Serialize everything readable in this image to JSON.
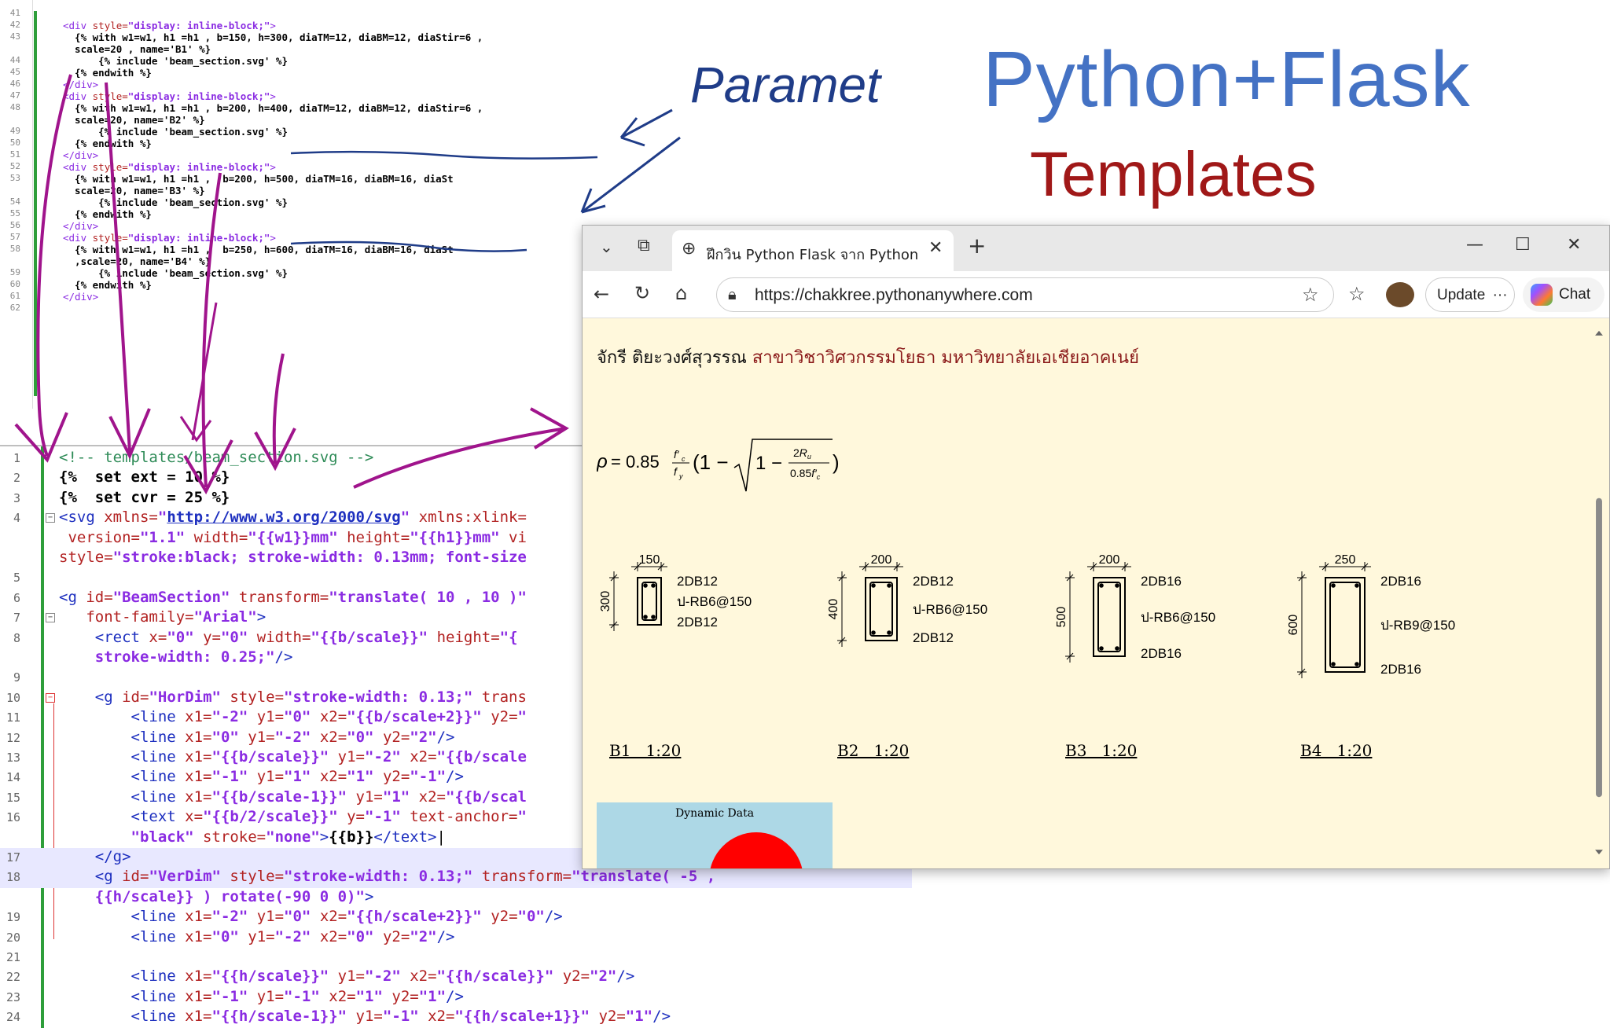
{
  "slide": {
    "title_main": "Python+Flask",
    "title_sub": "Templates",
    "handwritten_note": "Paramet"
  },
  "top_editor": {
    "lines": [
      {
        "num": "41",
        "html": ""
      },
      {
        "num": "42",
        "html": "<span class='tag'>&lt;div</span> <span class='attr'>style=</span><span class='str'>\"display: inline-block;\"</span><span class='tag'>&gt;</span>"
      },
      {
        "num": "43",
        "html": "  {% with w1=w1, h1 =h1 , b=150, h=300, diaTM=12, diaBM=12, diaStir=6 ,"
      },
      {
        "num": "",
        "html": "  scale=20 , name='B1' %}"
      },
      {
        "num": "44",
        "html": "      {% include 'beam_section.svg' %}"
      },
      {
        "num": "45",
        "html": "  {% endwith %}"
      },
      {
        "num": "46",
        "html": "<span class='tag'>&lt;/div&gt;</span>"
      },
      {
        "num": "47",
        "html": "<span class='tag'>&lt;div</span> <span class='attr'>style=</span><span class='str'>\"display: inline-block;\"</span><span class='tag'>&gt;</span>"
      },
      {
        "num": "48",
        "html": "  {% with w1=w1, h1 =h1 , b=200, h=400, diaTM=12, diaBM=12, diaStir=6 ,"
      },
      {
        "num": "",
        "html": "  scale=20, name='B2' %}"
      },
      {
        "num": "49",
        "html": "      {% include 'beam_section.svg' %}"
      },
      {
        "num": "50",
        "html": "  {% endwith %}"
      },
      {
        "num": "51",
        "html": "<span class='tag'>&lt;/div&gt;</span>"
      },
      {
        "num": "52",
        "html": "<span class='tag'>&lt;div</span> <span class='attr'>style=</span><span class='str'>\"display: inline-block;\"</span><span class='tag'>&gt;</span>"
      },
      {
        "num": "53",
        "html": "  {% with w1=w1, h1 =h1 ,  b=200, h=500, diaTM=16, diaBM=16, diaSt"
      },
      {
        "num": "",
        "html": "  scale=20, name='B3' %}"
      },
      {
        "num": "54",
        "html": "      {% include 'beam_section.svg' %}"
      },
      {
        "num": "55",
        "html": "  {% endwith %}"
      },
      {
        "num": "56",
        "html": "<span class='tag'>&lt;/div&gt;</span>"
      },
      {
        "num": "57",
        "html": "<span class='tag'>&lt;div</span> <span class='attr'>style=</span><span class='str'>\"display: inline-block;\"</span><span class='tag'>&gt;</span>"
      },
      {
        "num": "58",
        "html": "  {% with w1=w1, h1 =h1 ,  b=250, h=600, diaTM=16, diaBM=16, diaSt"
      },
      {
        "num": "",
        "html": "  ,scale=20, name='B4' %}"
      },
      {
        "num": "59",
        "html": "      {% include 'beam_section.svg' %}"
      },
      {
        "num": "60",
        "html": "  {% endwith %}"
      },
      {
        "num": "61",
        "html": "<span class='tag'>&lt;/div&gt;</span>"
      },
      {
        "num": "62",
        "html": ""
      }
    ]
  },
  "bottom_editor": {
    "lines": [
      {
        "num": "1",
        "html": "<span class='c-com'>&lt;!-- templates/beam_section.svg --&gt;</span>"
      },
      {
        "num": "2",
        "html": "<span class='c-jinja'>{%  set ext = 10 %}</span>"
      },
      {
        "num": "3",
        "html": "<span class='c-jinja'>{%  set cvr = 25 %}</span>"
      },
      {
        "num": "4",
        "html": "<span class='c-tag'>&lt;svg</span> <span class='c-attr'>xmlns=</span><span class='c-str'>\"</span><span class='c-link'>http://www.w3.org/2000/svg</span><span class='c-str'>\"</span> <span class='c-attr'>xmlns:xlink=</span>"
      },
      {
        "num": "",
        "html": " <span class='c-attr'>version=</span><span class='c-str'>\"1.1\"</span> <span class='c-attr'>width=</span><span class='c-str'>\"{{w1}}mm\"</span> <span class='c-attr'>height=</span><span class='c-str'>\"{{h1}}mm\"</span> <span class='c-attr'>vi</span>"
      },
      {
        "num": "",
        "html": "<span class='c-attr'>style=</span><span class='c-str'>\"stroke:black; stroke-width: 0.13mm; font-size</span>"
      },
      {
        "num": "5",
        "html": ""
      },
      {
        "num": "6",
        "html": "<span class='c-tag'>&lt;g</span> <span class='c-attr'>id=</span><span class='c-str'>\"BeamSection\"</span> <span class='c-attr'>transform=</span><span class='c-str'>\"translate( 10 , 10 )\"</span>"
      },
      {
        "num": "7",
        "html": "   <span class='c-attr'>font-family=</span><span class='c-str'>\"Arial\"</span><span class='c-tag'>&gt;</span>"
      },
      {
        "num": "8",
        "html": "    <span class='c-tag'>&lt;rect</span> <span class='c-attr'>x=</span><span class='c-str'>\"0\"</span> <span class='c-attr'>y=</span><span class='c-str'>\"0\"</span> <span class='c-attr'>width=</span><span class='c-str'>\"{{b/scale}}\"</span> <span class='c-attr'>height=</span><span class='c-str'>\"{</span>"
      },
      {
        "num": "",
        "html": "    <span class='c-str'>stroke-width: 0.25;\"</span><span class='c-tag'>/&gt;</span>"
      },
      {
        "num": "9",
        "html": ""
      },
      {
        "num": "10",
        "html": "    <span class='c-tag'>&lt;g</span> <span class='c-attr'>id=</span><span class='c-str'>\"HorDim\"</span> <span class='c-attr'>style=</span><span class='c-str'>\"stroke-width: 0.13;\"</span> <span class='c-attr'>trans</span>"
      },
      {
        "num": "11",
        "html": "        <span class='c-tag'>&lt;line</span> <span class='c-attr'>x1=</span><span class='c-str'>\"-2\"</span> <span class='c-attr'>y1=</span><span class='c-str'>\"0\"</span> <span class='c-attr'>x2=</span><span class='c-str'>\"{{b/scale+2}}\"</span> <span class='c-attr'>y2=</span><span class='c-str'>\"</span>"
      },
      {
        "num": "12",
        "html": "        <span class='c-tag'>&lt;line</span> <span class='c-attr'>x1=</span><span class='c-str'>\"0\"</span> <span class='c-attr'>y1=</span><span class='c-str'>\"-2\"</span> <span class='c-attr'>x2=</span><span class='c-str'>\"0\"</span> <span class='c-attr'>y2=</span><span class='c-str'>\"2\"</span><span class='c-tag'>/&gt;</span>"
      },
      {
        "num": "13",
        "html": "        <span class='c-tag'>&lt;line</span> <span class='c-attr'>x1=</span><span class='c-str'>\"{{b/scale}}\"</span> <span class='c-attr'>y1=</span><span class='c-str'>\"-2\"</span> <span class='c-attr'>x2=</span><span class='c-str'>\"{{b/scale</span>"
      },
      {
        "num": "14",
        "html": "        <span class='c-tag'>&lt;line</span> <span class='c-attr'>x1=</span><span class='c-str'>\"-1\"</span> <span class='c-attr'>y1=</span><span class='c-str'>\"1\"</span> <span class='c-attr'>x2=</span><span class='c-str'>\"1\"</span> <span class='c-attr'>y2=</span><span class='c-str'>\"-1\"</span><span class='c-tag'>/&gt;</span>"
      },
      {
        "num": "15",
        "html": "        <span class='c-tag'>&lt;line</span> <span class='c-attr'>x1=</span><span class='c-str'>\"{{b/scale-1}}\"</span> <span class='c-attr'>y1=</span><span class='c-str'>\"1\"</span> <span class='c-attr'>x2=</span><span class='c-str'>\"{{b/scal</span>"
      },
      {
        "num": "16",
        "html": "        <span class='c-tag'>&lt;text</span> <span class='c-attr'>x=</span><span class='c-str'>\"{{b/2/scale}}\"</span> <span class='c-attr'>y=</span><span class='c-str'>\"-1\"</span> <span class='c-attr'>text-anchor=</span><span class='c-str'>\"</span>"
      },
      {
        "num": "",
        "html": "        <span class='c-str'>\"black\"</span> <span class='c-attr'>stroke=</span><span class='c-str'>\"none\"</span><span class='c-tag'>&gt;</span><span class='c-jinja'>{{b}}</span><span class='c-tag'>&lt;/text&gt;</span>|"
      },
      {
        "num": "17",
        "html": "    <span class='c-tag'>&lt;/g&gt;</span>"
      },
      {
        "num": "18",
        "html": "    <span class='c-tag'>&lt;g</span> <span class='c-attr'>id=</span><span class='c-str'>\"VerDim\"</span> <span class='c-attr'>style=</span><span class='c-str'>\"stroke-width: 0.13;\"</span> <span class='c-attr'>transform=</span><span class='c-str'>\"translate( -5 ,</span>"
      },
      {
        "num": "",
        "html": "    <span class='c-str'>{{h/scale}} ) rotate(-90 0 0)\"</span><span class='c-tag'>&gt;</span>"
      },
      {
        "num": "19",
        "html": "        <span class='c-tag'>&lt;line</span> <span class='c-attr'>x1=</span><span class='c-str'>\"-2\"</span> <span class='c-attr'>y1=</span><span class='c-str'>\"0\"</span> <span class='c-attr'>x2=</span><span class='c-str'>\"{{h/scale+2}}\"</span> <span class='c-attr'>y2=</span><span class='c-str'>\"0\"</span><span class='c-tag'>/&gt;</span>"
      },
      {
        "num": "20",
        "html": "        <span class='c-tag'>&lt;line</span> <span class='c-attr'>x1=</span><span class='c-str'>\"0\"</span> <span class='c-attr'>y1=</span><span class='c-str'>\"-2\"</span> <span class='c-attr'>x2=</span><span class='c-str'>\"0\"</span> <span class='c-attr'>y2=</span><span class='c-str'>\"2\"</span><span class='c-tag'>/&gt;</span>"
      },
      {
        "num": "21",
        "html": ""
      },
      {
        "num": "22",
        "html": "        <span class='c-tag'>&lt;line</span> <span class='c-attr'>x1=</span><span class='c-str'>\"{{h/scale}}\"</span> <span class='c-attr'>y1=</span><span class='c-str'>\"-2\"</span> <span class='c-attr'>x2=</span><span class='c-str'>\"{{h/scale}}\"</span> <span class='c-attr'>y2=</span><span class='c-str'>\"2\"</span><span class='c-tag'>/&gt;</span>"
      },
      {
        "num": "23",
        "html": "        <span class='c-tag'>&lt;line</span> <span class='c-attr'>x1=</span><span class='c-str'>\"-1\"</span> <span class='c-attr'>y1=</span><span class='c-str'>\"-1\"</span> <span class='c-attr'>x2=</span><span class='c-str'>\"1\"</span> <span class='c-attr'>y2=</span><span class='c-str'>\"1\"</span><span class='c-tag'>/&gt;</span>"
      },
      {
        "num": "24",
        "html": "        <span class='c-tag'>&lt;line</span> <span class='c-attr'>x1=</span><span class='c-str'>\"{{h/scale-1}}\"</span> <span class='c-attr'>y1=</span><span class='c-str'>\"-1\"</span> <span class='c-attr'>x2=</span><span class='c-str'>\"{{h/scale+1}}\"</span> <span class='c-attr'>y2=</span><span class='c-str'>\"1\"</span><span class='c-tag'>/&gt;</span>"
      }
    ]
  },
  "browser": {
    "tab_title": "ฝึกวิน Python Flask จาก Pythonany",
    "url": "https://chakkree.pythonanywhere.com",
    "update_label": "Update",
    "chat_label": "Chat",
    "author_name": "จักรี ติยะวงศ์สุวรรณ",
    "author_affiliation": "สาขาวิชาวิศวกรรมโยธา มหาวิทยาลัยเอเชียอาคเนย์",
    "dynamic_label": "Dynamic Data",
    "beams": [
      {
        "b": "150",
        "h": "300",
        "top": "2DB12",
        "stirrup": "ป-RB6@150",
        "bottom": "2DB12",
        "caption": "B1   1:20"
      },
      {
        "b": "200",
        "h": "400",
        "top": "2DB12",
        "stirrup": "ป-RB6@150",
        "bottom": "2DB12",
        "caption": "B2   1:20"
      },
      {
        "b": "200",
        "h": "500",
        "top": "2DB16",
        "stirrup": "ป-RB6@150",
        "bottom": "2DB16",
        "caption": "B3   1:20"
      },
      {
        "b": "250",
        "h": "600",
        "top": "2DB16",
        "stirrup": "ป-RB9@150",
        "bottom": "2DB16",
        "caption": "B4   1:20"
      }
    ]
  },
  "colors": {
    "title_blue": "#4472c4",
    "title_red": "#a01818",
    "annotation_purple": "#a0148c",
    "annotation_blue": "#1f3c88",
    "page_background": "#fff8dc"
  }
}
